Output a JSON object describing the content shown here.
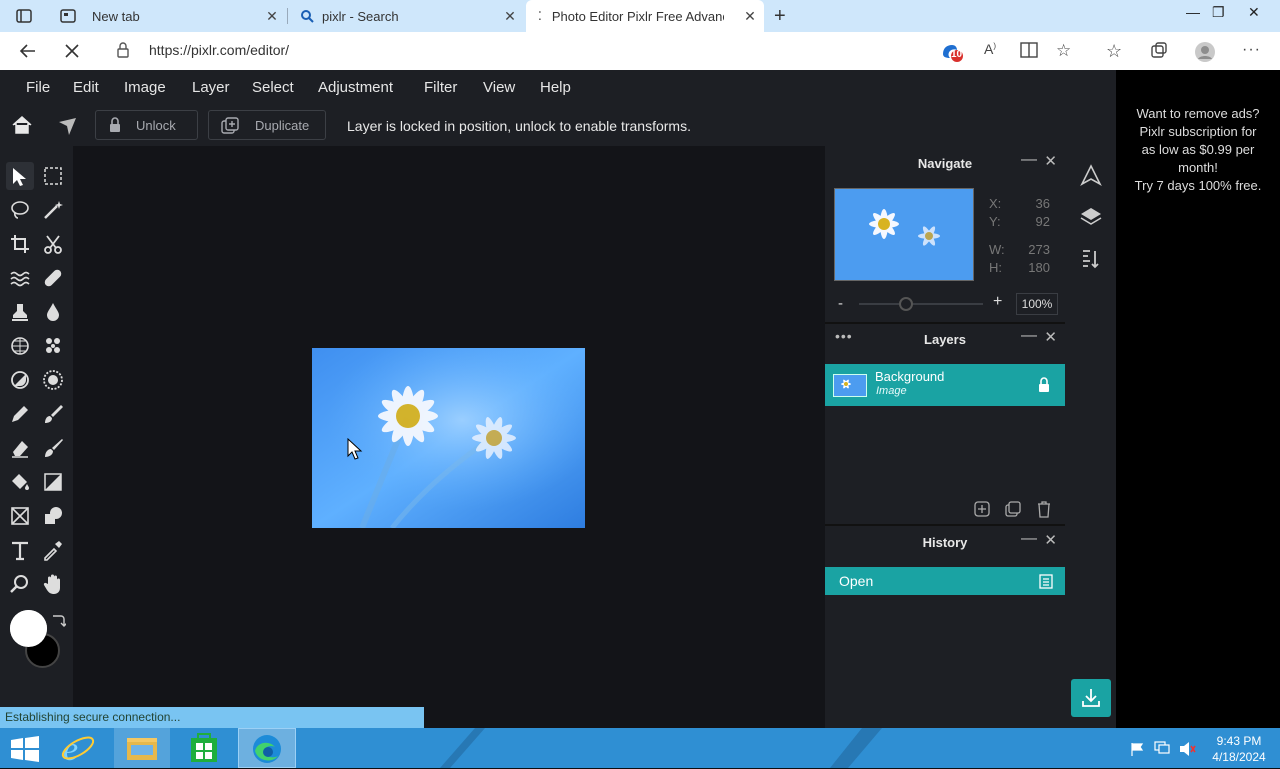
{
  "browser": {
    "tabs": [
      {
        "title": "New tab",
        "icon": "newtab-icon"
      },
      {
        "title": "pixlr - Search",
        "icon": "search-icon"
      },
      {
        "title": "Photo Editor Pixlr Free Advanced",
        "icon": "loading-icon"
      }
    ],
    "url": "https://pixlr.com/editor/",
    "badge_count": "10"
  },
  "menu": [
    "File",
    "Edit",
    "Image",
    "Layer",
    "Select",
    "Adjustment",
    "Filter",
    "View",
    "Help"
  ],
  "options": {
    "unlock_label": "Unlock",
    "duplicate_label": "Duplicate",
    "message": "Layer is locked in position, unlock to enable transforms."
  },
  "navigate": {
    "title": "Navigate",
    "x_label": "X:",
    "x_value": "36",
    "y_label": "Y:",
    "y_value": "92",
    "w_label": "W:",
    "w_value": "273",
    "h_label": "H:",
    "h_value": "180",
    "zoom_minus": "-",
    "zoom_plus": "+",
    "zoom": "100%"
  },
  "layers": {
    "title": "Layers",
    "items": [
      {
        "name": "Background",
        "type": "Image"
      }
    ]
  },
  "history": {
    "title": "History",
    "items": [
      "Open"
    ]
  },
  "ad": {
    "line1": "Want to remove ads?",
    "line2": "Pixlr subscription for",
    "line3": "as low as $0.99 per",
    "line4": "month!",
    "line5": "Try 7 days 100% free."
  },
  "status": "Establishing secure connection...",
  "clock": {
    "time": "9:43 PM",
    "date": "4/18/2024"
  },
  "colors": {
    "accent": "#1aa3a3",
    "panel": "#1d1f24",
    "canvas": "#131418"
  }
}
